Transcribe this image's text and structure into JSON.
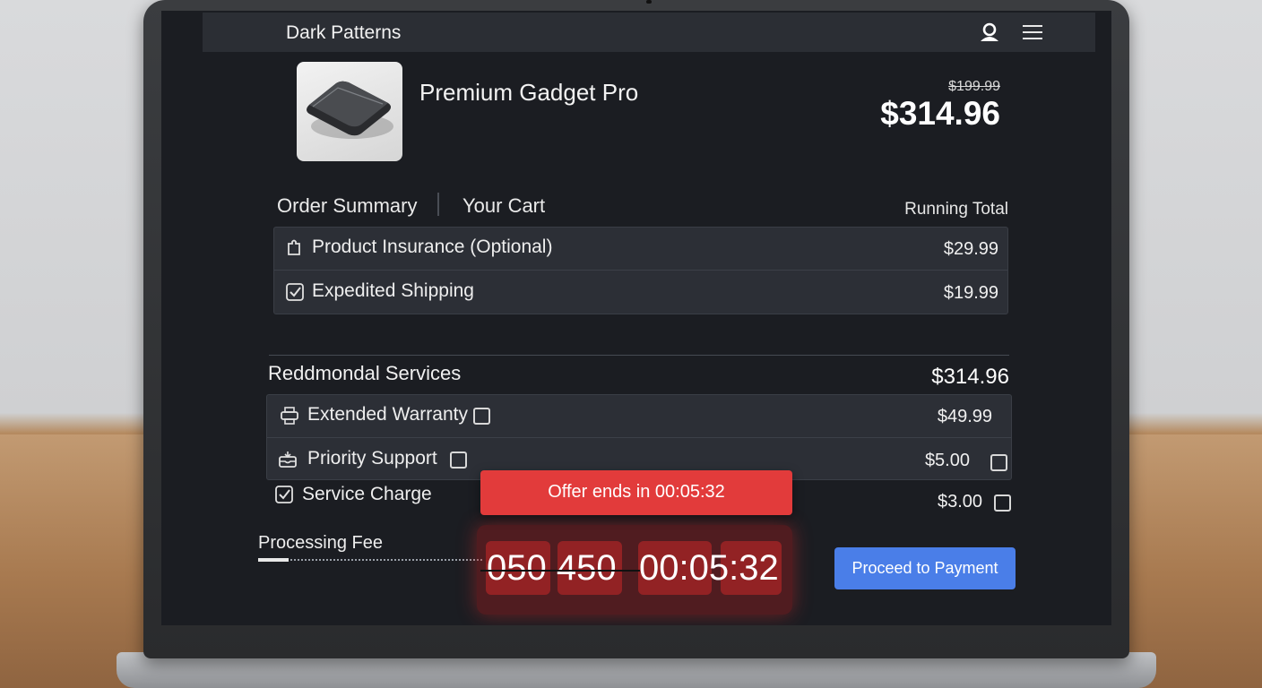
{
  "header": {
    "brand": "Dark Patterns",
    "icons": [
      "user-icon",
      "menu-icon"
    ]
  },
  "product": {
    "title": "Premium Gadget Pro",
    "original_price": "$199.99",
    "price": "$314.96",
    "image_icon": "hard-drive-image"
  },
  "tabs": [
    "Order Summary",
    "Your Cart"
  ],
  "running_total_label": "Running Total",
  "cart_items": [
    {
      "label": "Product Insurance (Optional)",
      "price": "$29.99",
      "icon": "puzzle-icon"
    },
    {
      "label": "Expedited Shipping",
      "price": "$19.99",
      "icon": "checked-box-icon"
    }
  ],
  "services": {
    "title": "Reddmondal Services",
    "total": "$314.96",
    "items": [
      {
        "label": "Extended Warranty",
        "price": "$49.99",
        "icon": "printer-icon"
      },
      {
        "label": "Priority Support",
        "price": "$5.00",
        "icon": "inbox-icon"
      }
    ]
  },
  "service_charge": {
    "label": "Service Charge",
    "price": "$3.00",
    "icon": "checked-box-icon"
  },
  "offer": {
    "text": "Offer ends in 00:05:32"
  },
  "processing": {
    "label": "Processing Fee"
  },
  "countdown": {
    "left_text": "050 450",
    "right_text": "00:05:32"
  },
  "cta": {
    "label": "Proceed to Payment"
  },
  "colors": {
    "accent": "#4a7ee8",
    "urgency": "#e23b3b",
    "background": "#1b1d22"
  }
}
